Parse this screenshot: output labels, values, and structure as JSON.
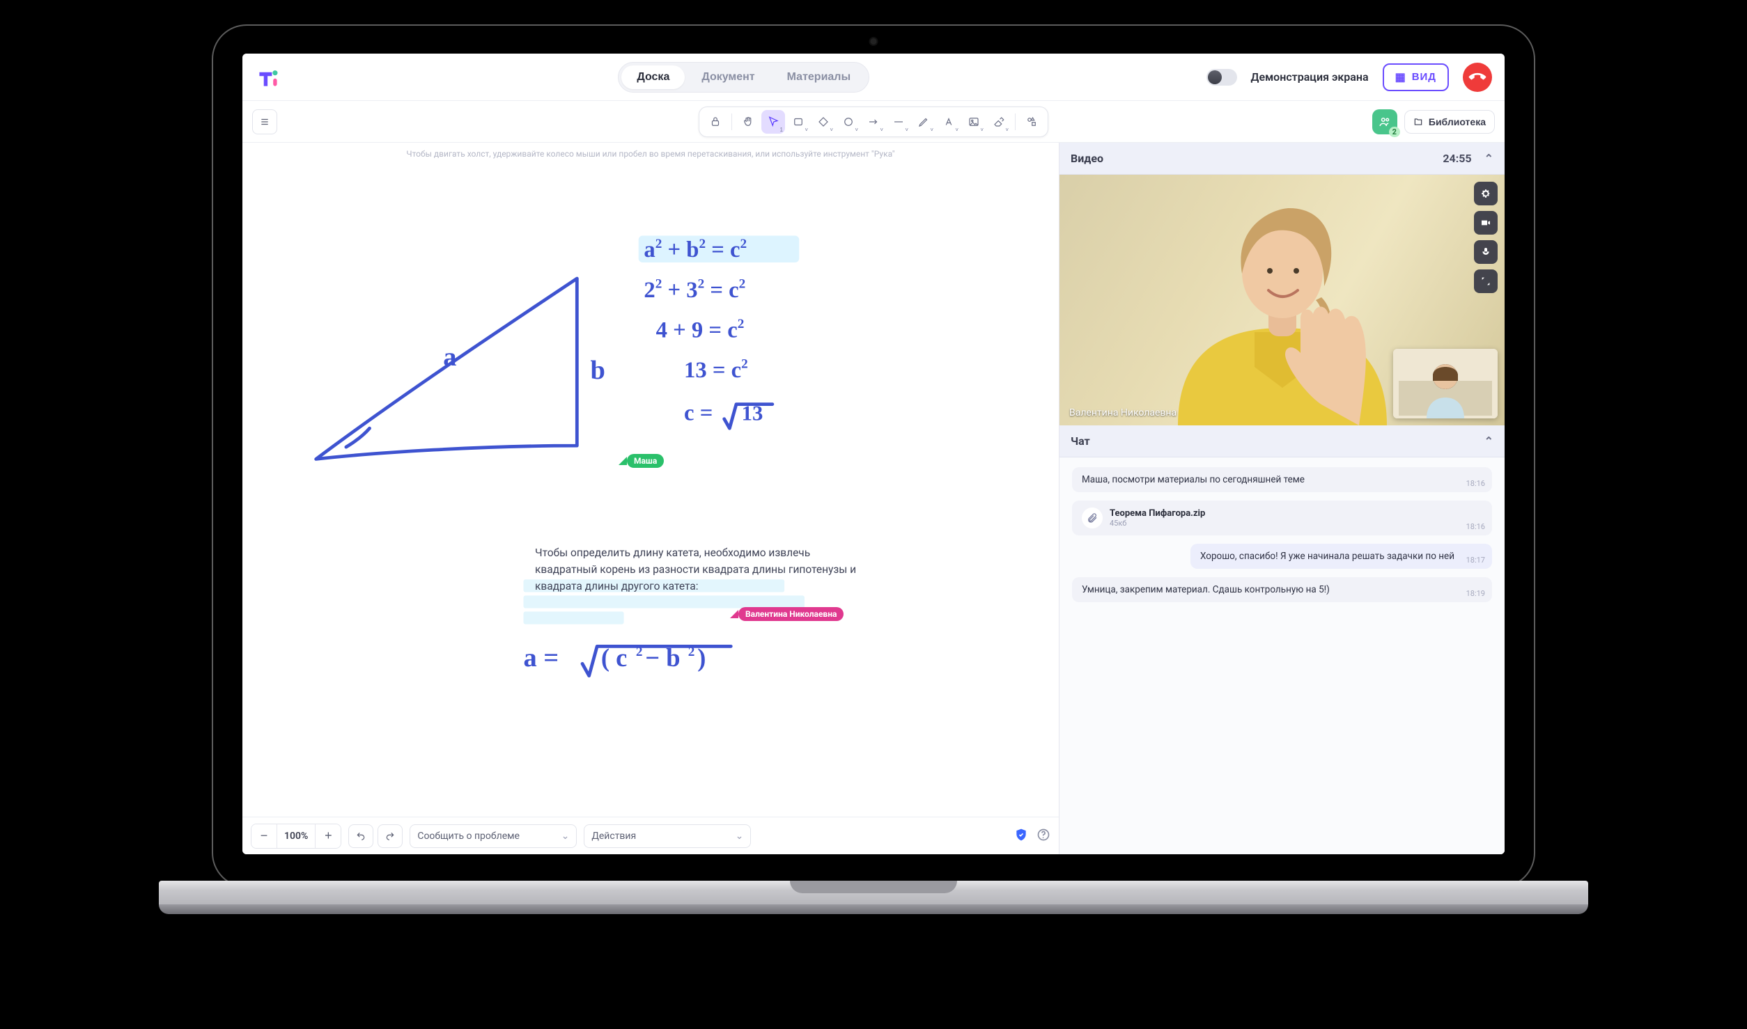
{
  "topbar": {
    "tabs": {
      "board": "Доска",
      "document": "Документ",
      "materials": "Материалы",
      "active": "board"
    },
    "share_label": "Демонстрация экрана",
    "view_label": "ВИД"
  },
  "toolbar": {
    "hint": "Чтобы двигать холст, удерживайте колесо мыши или пробел во время перетаскивания, или используйте инструмент \"Рука\"",
    "library_label": "Библиотека",
    "presence_count": "2",
    "active_tool": "select"
  },
  "canvas": {
    "triangle_labels": {
      "a": "a",
      "b": "b"
    },
    "equations": [
      "a² + b² = c²",
      "2² + 3² = c²",
      "4 + 9 = c²",
      "13 = c²",
      "c = √13"
    ],
    "cursors": {
      "green": "Маша",
      "pink": "Валентина Николаевна"
    },
    "paragraph": "Чтобы определить длину катета, необходимо извлечь квадратный корень из разности квадрата длины гипотенузы и квадрата длины другого катета:",
    "formula_text": "a = √(c² − b²)"
  },
  "bottombar": {
    "zoom": "100%",
    "report_label": "Сообщить о проблеме",
    "actions_label": "Действия"
  },
  "side": {
    "video": {
      "title": "Видео",
      "timer": "24:55",
      "name": "Валентина Николаевна"
    },
    "chat": {
      "title": "Чат",
      "messages": [
        {
          "id": "m1",
          "kind": "text",
          "side": "in",
          "text": "Маша, посмотри материалы по сегодняшней теме",
          "time": "18:16"
        },
        {
          "id": "m2",
          "kind": "file",
          "side": "in",
          "filename": "Теорема Пифагора.zip",
          "size": "45кб",
          "time": "18:16"
        },
        {
          "id": "m3",
          "kind": "text",
          "side": "out",
          "text": "Хорошо, спасибо! Я уже начинала решать задачки по ней",
          "time": "18:17"
        },
        {
          "id": "m4",
          "kind": "text",
          "side": "in",
          "text": "Умница, закрепим материал. Сдашь контрольную на 5!)",
          "time": "18:19"
        }
      ]
    }
  }
}
